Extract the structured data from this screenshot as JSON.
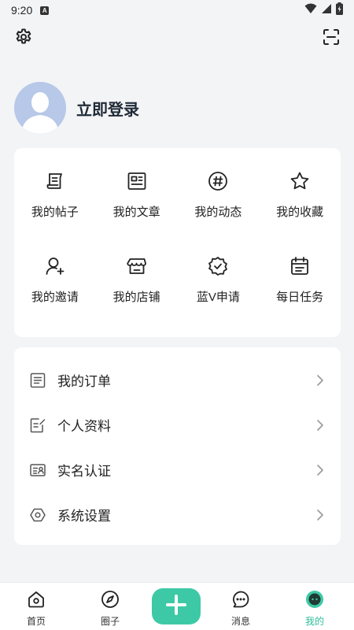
{
  "status_bar": {
    "time": "9:20",
    "sim_badge": "A"
  },
  "profile": {
    "login_label": "立即登录"
  },
  "grid": [
    {
      "label": "我的帖子",
      "icon": "post-icon"
    },
    {
      "label": "我的文章",
      "icon": "article-icon"
    },
    {
      "label": "我的动态",
      "icon": "hashtag-icon"
    },
    {
      "label": "我的收藏",
      "icon": "star-icon"
    },
    {
      "label": "我的邀请",
      "icon": "invite-user-icon"
    },
    {
      "label": "我的店铺",
      "icon": "store-icon"
    },
    {
      "label": "蓝V申请",
      "icon": "verified-badge-icon"
    },
    {
      "label": "每日任务",
      "icon": "calendar-task-icon"
    }
  ],
  "menu": [
    {
      "label": "我的订单",
      "icon": "order-list-icon"
    },
    {
      "label": "个人资料",
      "icon": "edit-profile-icon"
    },
    {
      "label": "实名认证",
      "icon": "id-card-icon"
    },
    {
      "label": "系统设置",
      "icon": "hexagon-settings-icon"
    }
  ],
  "nav": [
    {
      "label": "首页",
      "icon": "home-icon"
    },
    {
      "label": "圈子",
      "icon": "compass-icon"
    },
    {
      "label": "消息",
      "icon": "message-icon"
    },
    {
      "label": "我的",
      "icon": "mine-icon",
      "active": true
    }
  ],
  "colors": {
    "accent": "#3ec9a6",
    "accent_text": "#2dbf9a",
    "background": "#f3f4f6",
    "card": "#ffffff"
  }
}
